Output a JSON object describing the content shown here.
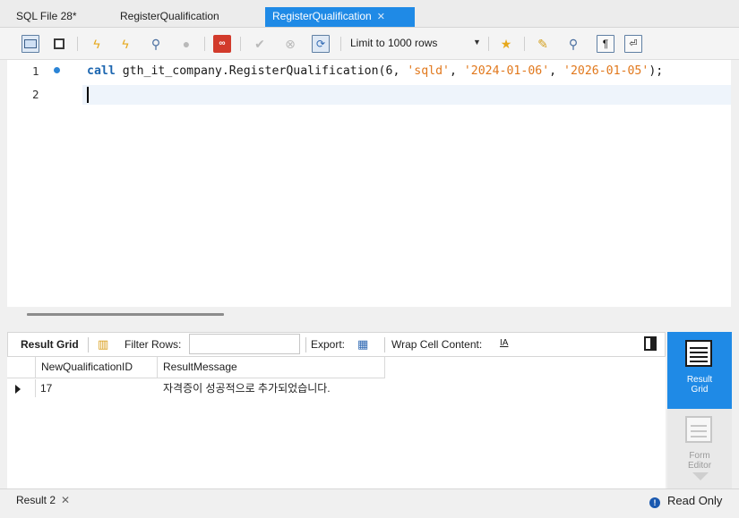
{
  "tabs": [
    {
      "label": "SQL File 28*",
      "active": false
    },
    {
      "label": "RegisterQualification",
      "active": false
    },
    {
      "label": "RegisterQualification",
      "active": true
    }
  ],
  "toolbar": {
    "limit_label": "Limit to 1000 rows",
    "icons": [
      "open-folder-icon",
      "save-icon",
      "execute-icon",
      "execute-current-icon",
      "explain-icon",
      "stop-icon",
      "toggle-error-icon",
      "commit-icon",
      "rollback-icon",
      "autocommit-icon",
      "add-snippet-icon",
      "beautify-icon",
      "find-icon",
      "invisible-chars-icon",
      "word-wrap-icon"
    ]
  },
  "editor": {
    "lines": [
      "1",
      "2"
    ],
    "code": {
      "kw": "call",
      "name": "gth_it_company.RegisterQualification(",
      "arg1": "6",
      "sep": ", ",
      "arg2": "'sqld'",
      "arg3": "'2024-01-06'",
      "arg4": "'2026-01-05'",
      "end": ");"
    }
  },
  "result_toolbar": {
    "result_grid": "Result Grid",
    "filter_rows": "Filter Rows:",
    "filter_value": "",
    "export": "Export:",
    "wrap": "Wrap Cell Content:",
    "wrap_icon": "IA"
  },
  "grid": {
    "columns": [
      "NewQualificationID",
      "ResultMessage"
    ],
    "rows": [
      [
        "17",
        "자격증이 성공적으로 추가되었습니다."
      ]
    ]
  },
  "side": {
    "result_grid": [
      "Result",
      "Grid"
    ],
    "form_editor": [
      "Form",
      "Editor"
    ]
  },
  "bottom": {
    "result_tab": "Result 2",
    "status": "Read Only"
  },
  "colors": {
    "accent": "#1f8ae6",
    "keyword": "#1c66b0",
    "string": "#e1781c"
  }
}
